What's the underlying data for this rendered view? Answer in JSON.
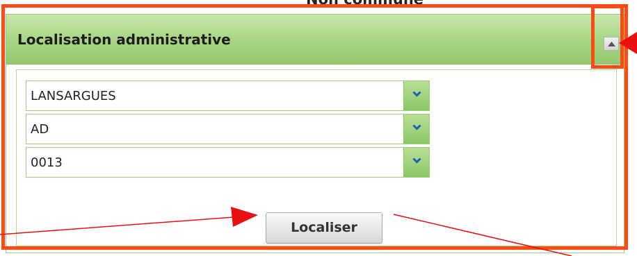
{
  "top_cut_text": "Non commune",
  "panel": {
    "title": "Localisation administrative",
    "collapse_icon": "triangle-up-icon"
  },
  "selects": [
    {
      "value": "LANSARGUES",
      "icon": "chevron-down-icon"
    },
    {
      "value": "AD",
      "icon": "chevron-down-icon"
    },
    {
      "value": "0013",
      "icon": "chevron-down-icon"
    }
  ],
  "localiser_button": {
    "label": "Localiser"
  },
  "annotation_color": "#ff4a12",
  "arrow_color": "#e81010",
  "panel_green": "#a9d687"
}
